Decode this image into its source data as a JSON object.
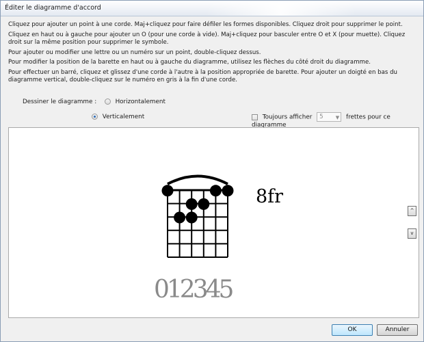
{
  "window": {
    "title": "Éditer le diagramme d'accord"
  },
  "instructions": [
    "Cliquez pour ajouter un point à une corde. Maj+cliquez pour faire défiler les formes disponibles. Cliquez droit pour supprimer le point.",
    "Cliquez en haut ou à gauche pour ajouter un O (pour une corde à vide). Maj+cliquez pour basculer entre O et X (pour muette). Cliquez droit sur la même position pour supprimer le symbole.",
    "Pour ajouter ou modifier une lettre ou un numéro sur un point, double-cliquez dessus.",
    "Pour modifier la position de la barette en haut ou à gauche du diagramme, utilisez les flèches du côté droit du diagramme.",
    "Pour effectuer un barré, cliquez et glissez d'une corde à l'autre à la position appropriée de barette. Pour ajouter un doigté en bas du diagramme vertical, double-cliquez sur le numéro en gris à la fin d'une corde."
  ],
  "orientation": {
    "label": "Dessiner le diagramme :",
    "horizontal_label": "Horizontalement",
    "vertical_label": "Verticalement",
    "selected": "vertical"
  },
  "always_show": {
    "label": "Toujours afficher",
    "value": "5",
    "suffix": "frettes pour ce diagramme",
    "checked": false
  },
  "diagram": {
    "fret_label": "8fr",
    "finger_numbers": "012345",
    "strings": 6,
    "frets": 5,
    "barre": {
      "from_string": 1,
      "to_string": 6
    },
    "dots": [
      {
        "string": 1,
        "fret": 0.5
      },
      {
        "string": 5,
        "fret": 0.5
      },
      {
        "string": 6,
        "fret": 0.5
      },
      {
        "string": 4,
        "fret": 1.5
      },
      {
        "string": 3,
        "fret": 1.5
      },
      {
        "string": 2,
        "fret": 2.5
      },
      {
        "string": 3,
        "fret": 2.5
      }
    ],
    "scroll_up": "^",
    "scroll_down": "v"
  },
  "buttons": {
    "ok": "OK",
    "cancel": "Annuler"
  }
}
